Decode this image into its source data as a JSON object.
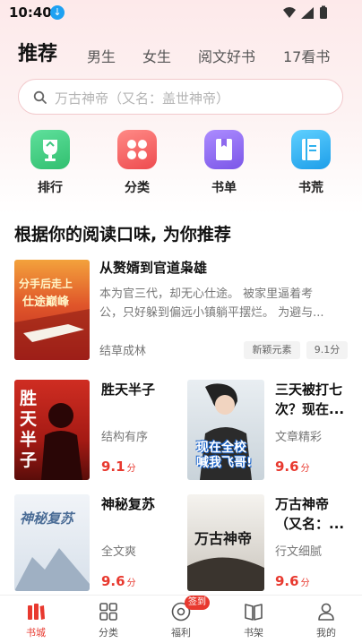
{
  "status_bar": {
    "time": "10:40"
  },
  "tabs": [
    {
      "label": "推荐",
      "active": true
    },
    {
      "label": "男生"
    },
    {
      "label": "女生"
    },
    {
      "label": "阅文好书"
    },
    {
      "label": "17看书"
    }
  ],
  "search": {
    "placeholder": "万古神帝（又名：盖世神帝）"
  },
  "quick_links": [
    {
      "label": "排行",
      "icon": "trophy-icon",
      "color": "#3ec780"
    },
    {
      "label": "分类",
      "icon": "grid-icon",
      "color": "#f0575a"
    },
    {
      "label": "书单",
      "icon": "book-icon",
      "color": "#8e69ee"
    },
    {
      "label": "书荒",
      "icon": "book-open-icon",
      "color": "#2fb1ee"
    }
  ],
  "section_title": "根据你的阅读口味, 为你推荐",
  "featured": {
    "title": "从赘婿到官道枭雄",
    "desc": [
      "本为官三代，却无心仕途。 被家里逼着考",
      "公，只好躲到偏远小镇躺平摆烂。 为避与..."
    ],
    "tag": "结草成林",
    "pills": [
      "新颖元素",
      "9.1分"
    ],
    "cover_text": [
      "分手后走上",
      "仕途巅峰"
    ]
  },
  "books": [
    {
      "title": [
        "胜天半子"
      ],
      "tag": "结构有序",
      "score": "9.1",
      "unit": "分",
      "cover_text": "胜天半子"
    },
    {
      "title": [
        "三天被打七",
        "次？现在..."
      ],
      "tag": "文章精彩",
      "score": "9.6",
      "unit": "分",
      "cover_text": "现在全校喊我飞哥!"
    },
    {
      "title": [
        "神秘复苏"
      ],
      "tag": "全文爽",
      "score": "9.6",
      "unit": "分",
      "cover_text": "神秘复苏"
    },
    {
      "title": [
        "万古神帝",
        "（又名：..."
      ],
      "tag": "行文细腻",
      "score": "9.6",
      "unit": "分",
      "cover_text": "万古神帝"
    }
  ],
  "nav": [
    {
      "label": "书城",
      "icon": "bookstore-icon",
      "active": true
    },
    {
      "label": "分类",
      "icon": "category-icon"
    },
    {
      "label": "福利",
      "icon": "welfare-icon",
      "badge": "签到"
    },
    {
      "label": "书架",
      "icon": "bookshelf-icon"
    },
    {
      "label": "我的",
      "icon": "profile-icon"
    }
  ],
  "colors": {
    "accent": "#e8392f",
    "tab_active": "#111111"
  }
}
